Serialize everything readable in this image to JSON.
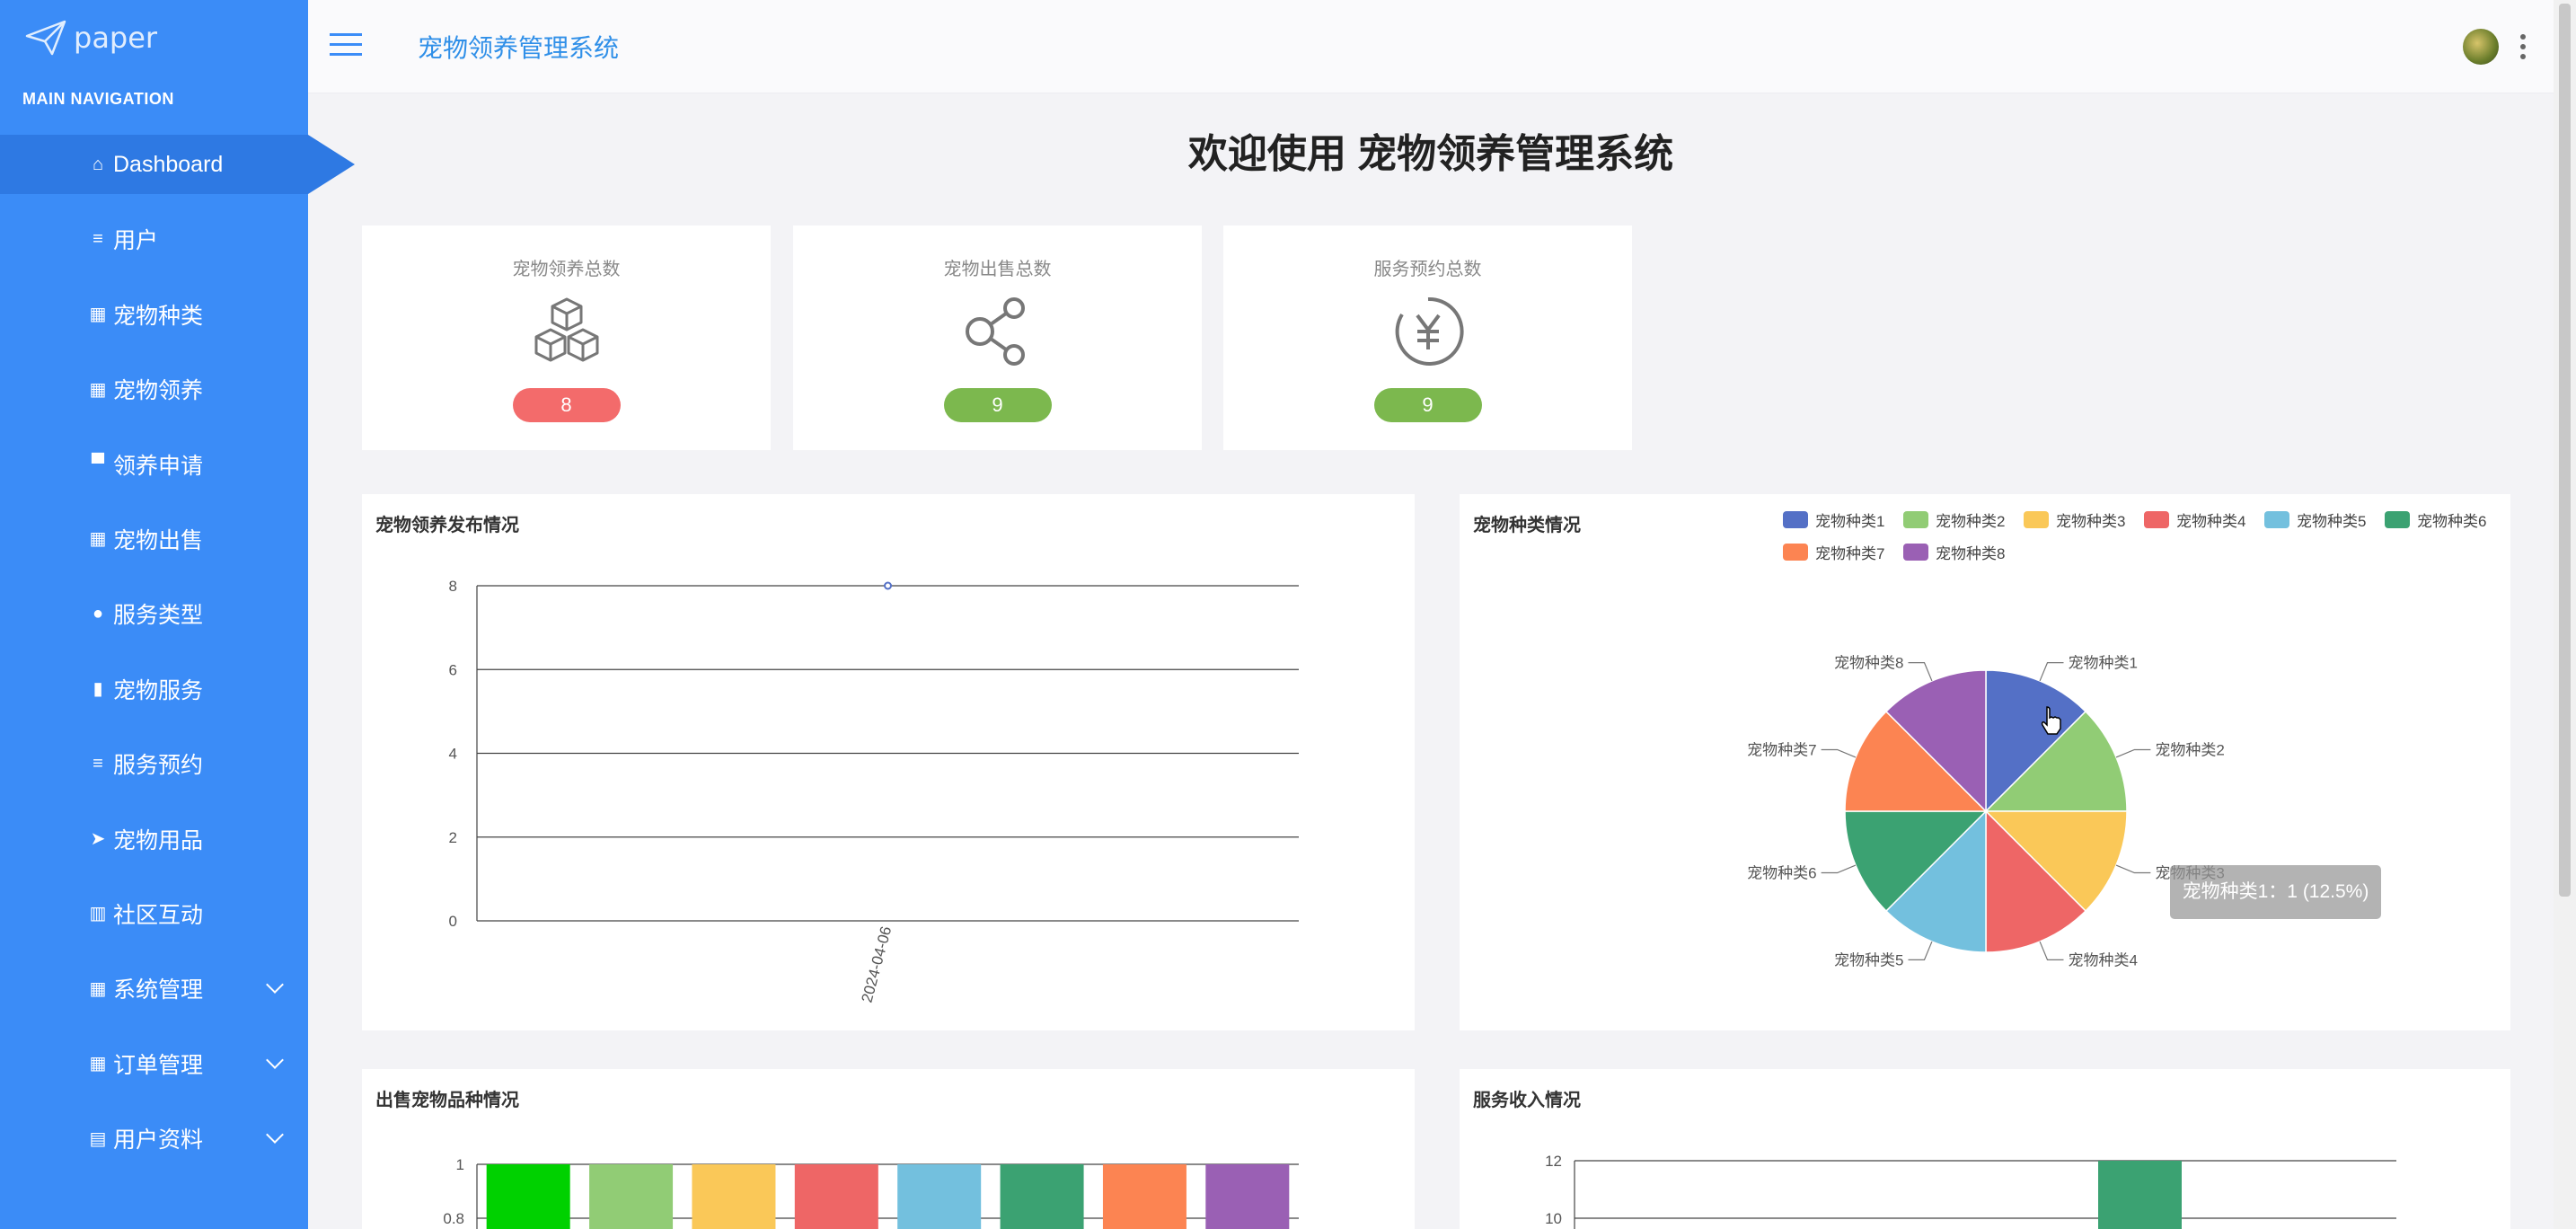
{
  "brand": {
    "logo_text": "paper"
  },
  "sidebar": {
    "caption": "MAIN NAVIGATION",
    "items": [
      {
        "label": "Dashboard",
        "icon": "home-icon",
        "glyph": "⌂"
      },
      {
        "label": "用户",
        "icon": "list-icon",
        "glyph": "≡"
      },
      {
        "label": "宠物种类",
        "icon": "grid-icon",
        "glyph": "▦"
      },
      {
        "label": "宠物领养",
        "icon": "grid-icon",
        "glyph": "▦"
      },
      {
        "label": "领养申请",
        "icon": "monitor-icon",
        "glyph": "▀"
      },
      {
        "label": "宠物出售",
        "icon": "grid-icon",
        "glyph": "▦"
      },
      {
        "label": "服务类型",
        "icon": "pin-icon",
        "glyph": "●"
      },
      {
        "label": "宠物服务",
        "icon": "book-icon",
        "glyph": "▮"
      },
      {
        "label": "服务预约",
        "icon": "sliders-icon",
        "glyph": "≡"
      },
      {
        "label": "宠物用品",
        "icon": "send-icon",
        "glyph": "➤"
      },
      {
        "label": "社区互动",
        "icon": "bar-chart-icon",
        "glyph": "▥"
      },
      {
        "label": "系统管理",
        "icon": "grid-icon",
        "glyph": "▦"
      },
      {
        "label": "订单管理",
        "icon": "grid-icon",
        "glyph": "▦"
      },
      {
        "label": "用户资料",
        "icon": "id-card-icon",
        "glyph": "▤"
      }
    ]
  },
  "header": {
    "title": "宠物领养管理系统"
  },
  "welcome": "欢迎使用 宠物领养管理系统",
  "stats": [
    {
      "title": "宠物领养总数",
      "value": "8",
      "color": "#f36b6b",
      "icon": "cubes-icon"
    },
    {
      "title": "宠物出售总数",
      "value": "9",
      "color": "#7cb84e",
      "icon": "share-icon"
    },
    {
      "title": "服务预约总数",
      "value": "9",
      "color": "#7cb84e",
      "icon": "yen-icon"
    }
  ],
  "panels": {
    "line_title": "宠物领养发布情况",
    "pie_title": "宠物种类情况",
    "bar_title": "出售宠物品种情况",
    "income_title": "服务收入情况"
  },
  "tooltip": "宠物种类1：1 (12.5%)",
  "chart_data": [
    {
      "type": "line",
      "title": "宠物领养发布情况",
      "x": [
        "2024-04-06"
      ],
      "values": [
        8
      ],
      "ylim": [
        0,
        8
      ],
      "yticks": [
        "0",
        "2",
        "4",
        "6",
        "8"
      ],
      "grid": true
    },
    {
      "type": "pie",
      "title": "宠物种类情况",
      "labels": [
        "宠物种类1",
        "宠物种类2",
        "宠物种类3",
        "宠物种类4",
        "宠物种类5",
        "宠物种类6",
        "宠物种类7",
        "宠物种类8"
      ],
      "values": [
        1,
        1,
        1,
        1,
        1,
        1,
        1,
        1
      ],
      "colors": [
        "#5470c6",
        "#91cc75",
        "#fac858",
        "#ee6666",
        "#73c0de",
        "#3ba272",
        "#fc8452",
        "#9a60b4"
      ],
      "legend": "top-right"
    },
    {
      "type": "bar",
      "title": "出售宠物品种情况",
      "values": [
        1,
        1,
        1,
        1,
        1,
        1,
        1,
        1
      ],
      "colors": [
        "#00d100",
        "#91cc75",
        "#fac858",
        "#ee6666",
        "#73c0de",
        "#3ba272",
        "#fc8452",
        "#9a60b4"
      ],
      "yticks": [
        "1",
        "0.8"
      ]
    },
    {
      "type": "bar",
      "title": "服务收入情况",
      "values": [
        12
      ],
      "colors": [
        "#3ba272"
      ],
      "yticks": [
        "12",
        "10"
      ]
    }
  ]
}
